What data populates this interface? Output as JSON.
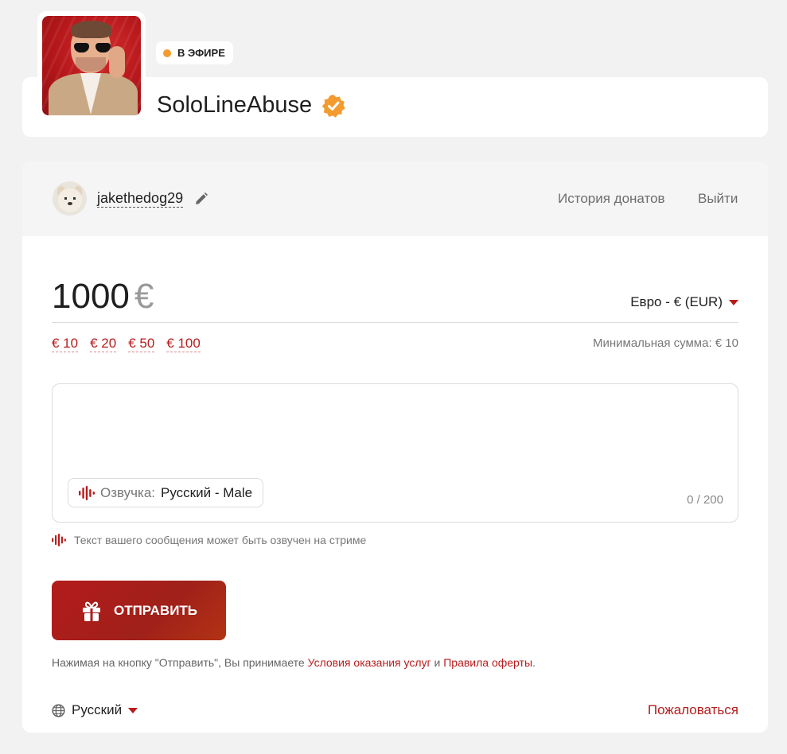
{
  "streamer": {
    "name": "SoloLineAbuse",
    "live_label": "В ЭФИРЕ",
    "verified": true,
    "avatar_icon": "streamer-photo"
  },
  "user": {
    "username": "jakethedog29",
    "history_label": "История донатов",
    "logout_label": "Выйти"
  },
  "donation": {
    "amount": "1000",
    "currency_symbol": "€",
    "currency_select": "Евро - € (EUR)",
    "presets": [
      "€ 10",
      "€ 20",
      "€ 50",
      "€ 100"
    ],
    "min_sum": "Минимальная сумма: € 10",
    "message_value": "",
    "voice_label": "Озвучка:",
    "voice_value": "Русский - Male",
    "char_count": "0 / 200",
    "hint": "Текст вашего сообщения может быть озвучен на стриме",
    "submit_label": "ОТПРАВИТЬ"
  },
  "terms": {
    "prefix": "Нажимая на кнопку \"Отправить\", Вы принимаете ",
    "link1": "Условия оказания услуг",
    "middle": " и ",
    "link2": "Правила оферты",
    "suffix": "."
  },
  "footer": {
    "language": "Русский",
    "complain": "Пожаловаться"
  },
  "colors": {
    "accent": "#b81c1c",
    "live_dot": "#f39b2f",
    "verified": "#f39b2f",
    "background": "#f2f2f2"
  }
}
